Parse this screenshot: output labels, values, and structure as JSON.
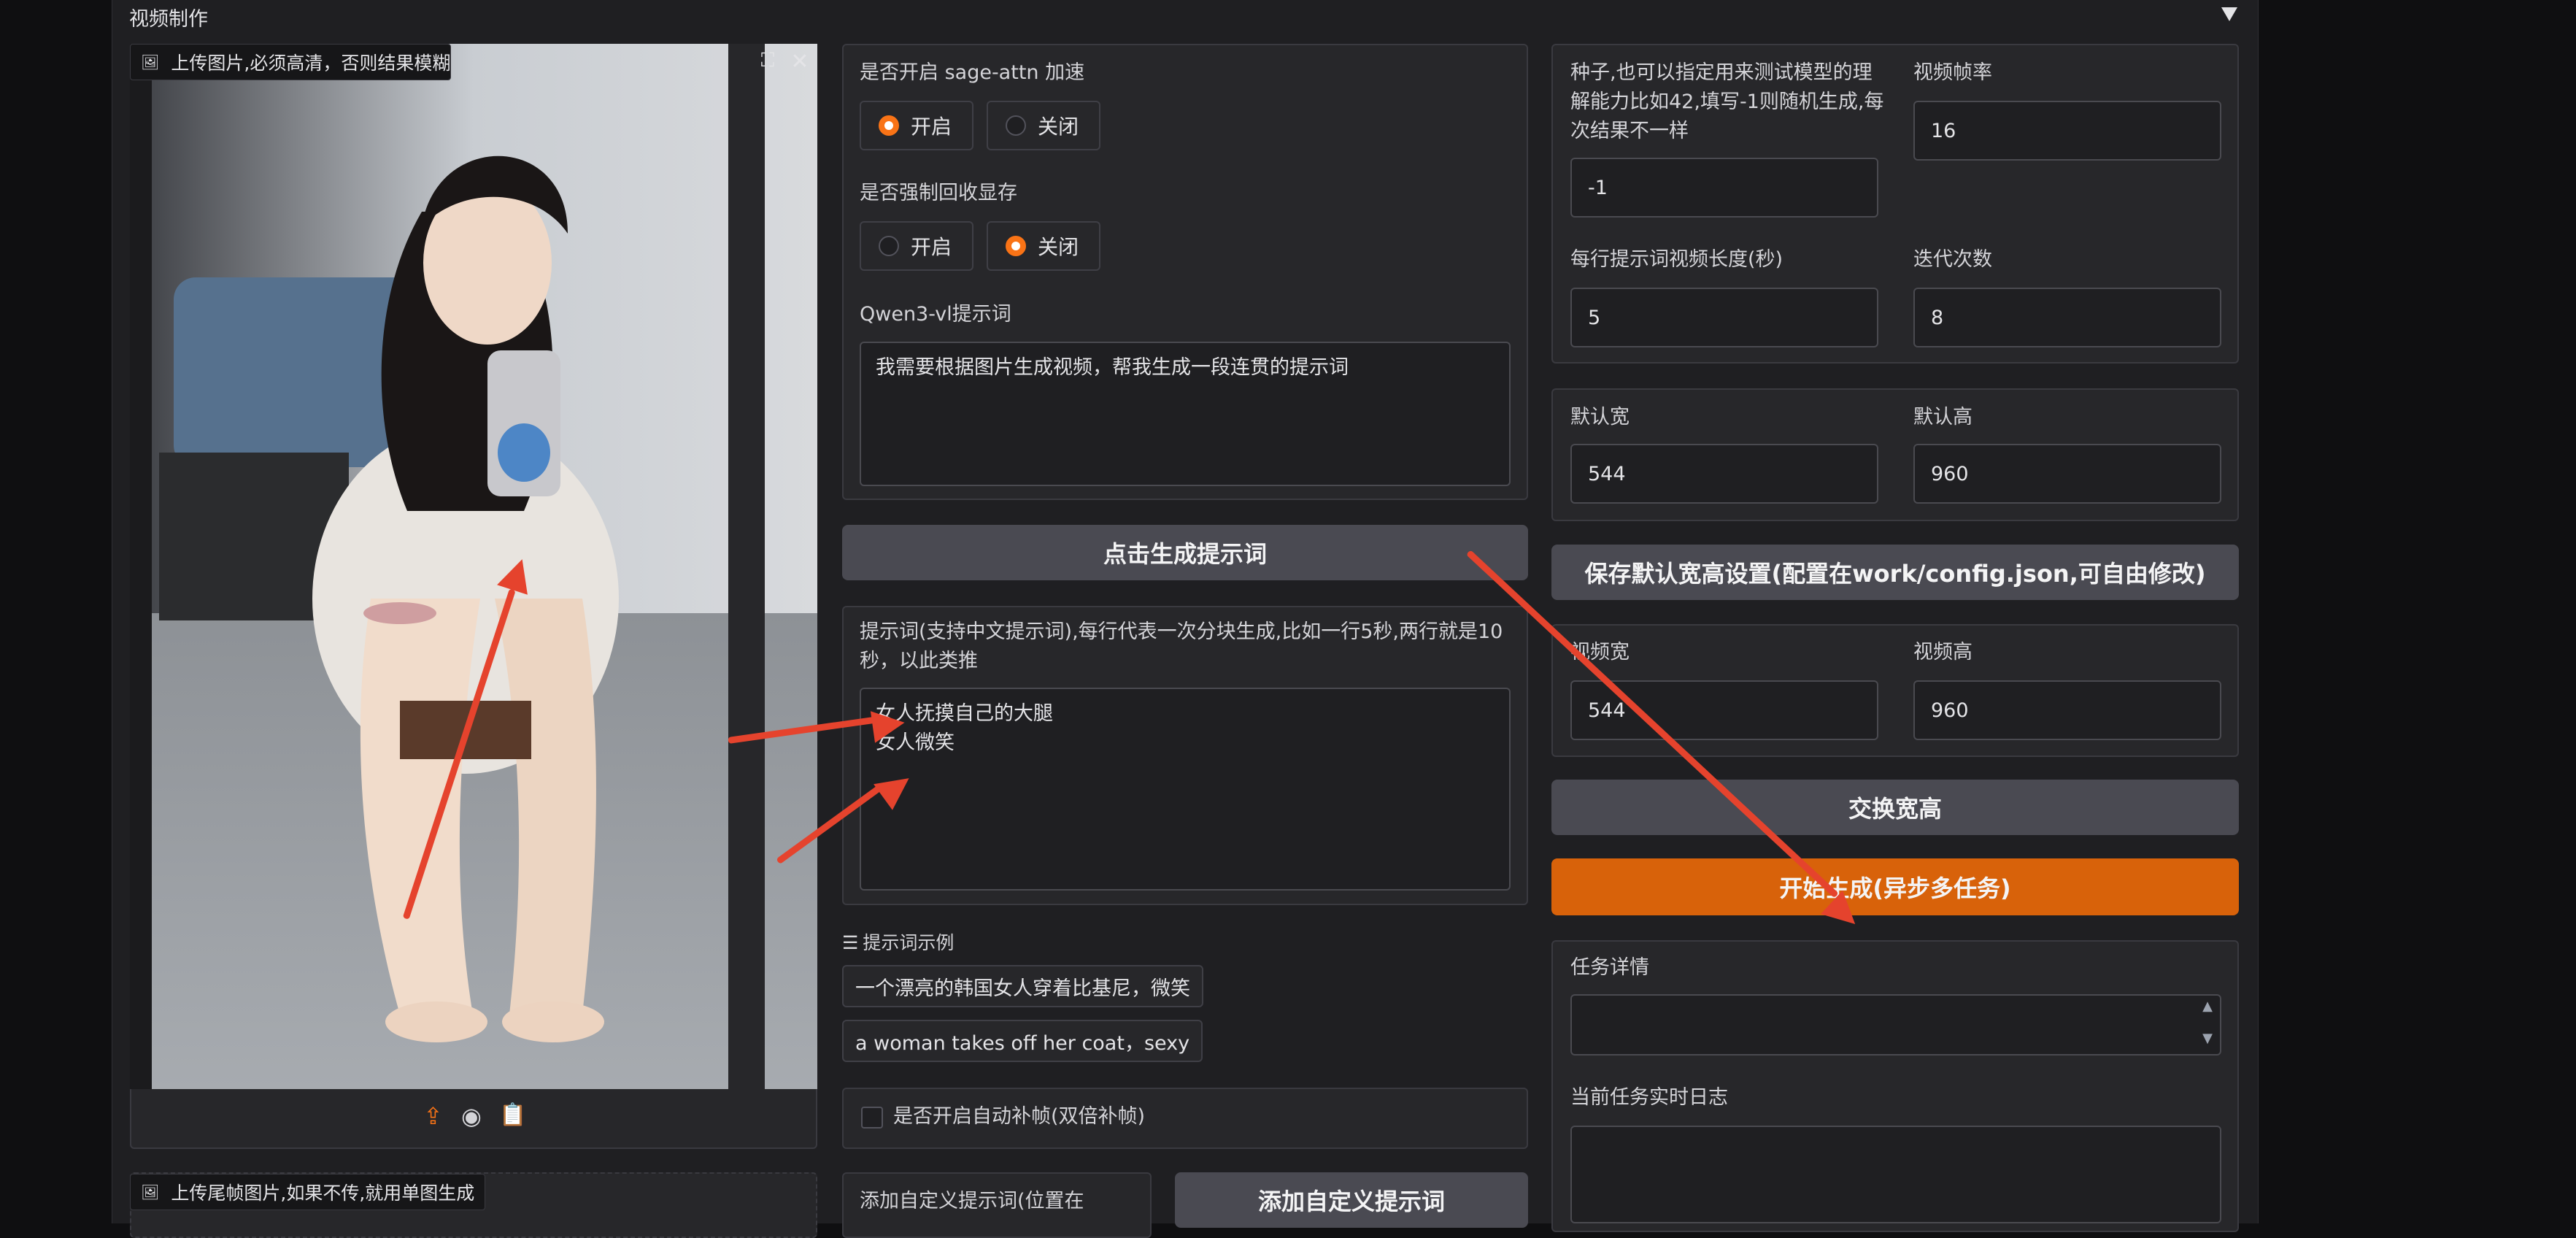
{
  "section_title": "视频制作",
  "image_panel": {
    "upload_label": "上传图片,必须高清，否则结果模糊",
    "tail_label": "上传尾帧图片,如果不传,就用单图生成"
  },
  "settings": {
    "sage_label": "是否开启 sage-attn 加速",
    "sage_options": [
      "开启",
      "关闭"
    ],
    "sage_selected": "开启",
    "vram_label": "是否强制回收显存",
    "vram_options": [
      "开启",
      "关闭"
    ],
    "vram_selected": "关闭",
    "qwen_label": "Qwen3-vl提示词",
    "qwen_value": "我需要根据图片生成视频，帮我生成一段连贯的提示词",
    "gen_prompt_button": "点击生成提示词",
    "prompt_label": "提示词(支持中文提示词),每行代表一次分块生成,比如一行5秒,两行就是10秒，以此类推",
    "prompt_value": "女人抚摸自己的大腿\n女人微笑",
    "examples_label": "提示词示例",
    "examples": [
      "一个漂亮的韩国女人穿着比基尼，微笑",
      "a woman takes off her coat，sexy"
    ],
    "interp_label": "是否开启自动补帧(双倍补帧)",
    "custom_prompt_label": "添加自定义提示词(位置在",
    "custom_prompt_button": "添加自定义提示词"
  },
  "right": {
    "seed_label": "种子,也可以指定用来测试模型的理解能力比如42,填写-1则随机生成,每次结果不一样",
    "seed_value": "-1",
    "fps_label": "视频帧率",
    "fps_value": "16",
    "len_label": "每行提示词视频长度(秒)",
    "len_value": "5",
    "iter_label": "迭代次数",
    "iter_value": "8",
    "dw_label": "默认宽",
    "dw_value": "544",
    "dh_label": "默认高",
    "dh_value": "960",
    "save_button": "保存默认宽高设置(配置在work/config.json,可自由修改)",
    "vw_label": "视频宽",
    "vw_value": "544",
    "vh_label": "视频高",
    "vh_value": "960",
    "swap_button": "交换宽高",
    "start_button": "开始生成(异步多任务)",
    "task_label": "任务详情",
    "log_label": "当前任务实时日志"
  },
  "colors": {
    "accent": "#d8620a",
    "annotation": "#e5432d",
    "button": "#4a4a52"
  }
}
